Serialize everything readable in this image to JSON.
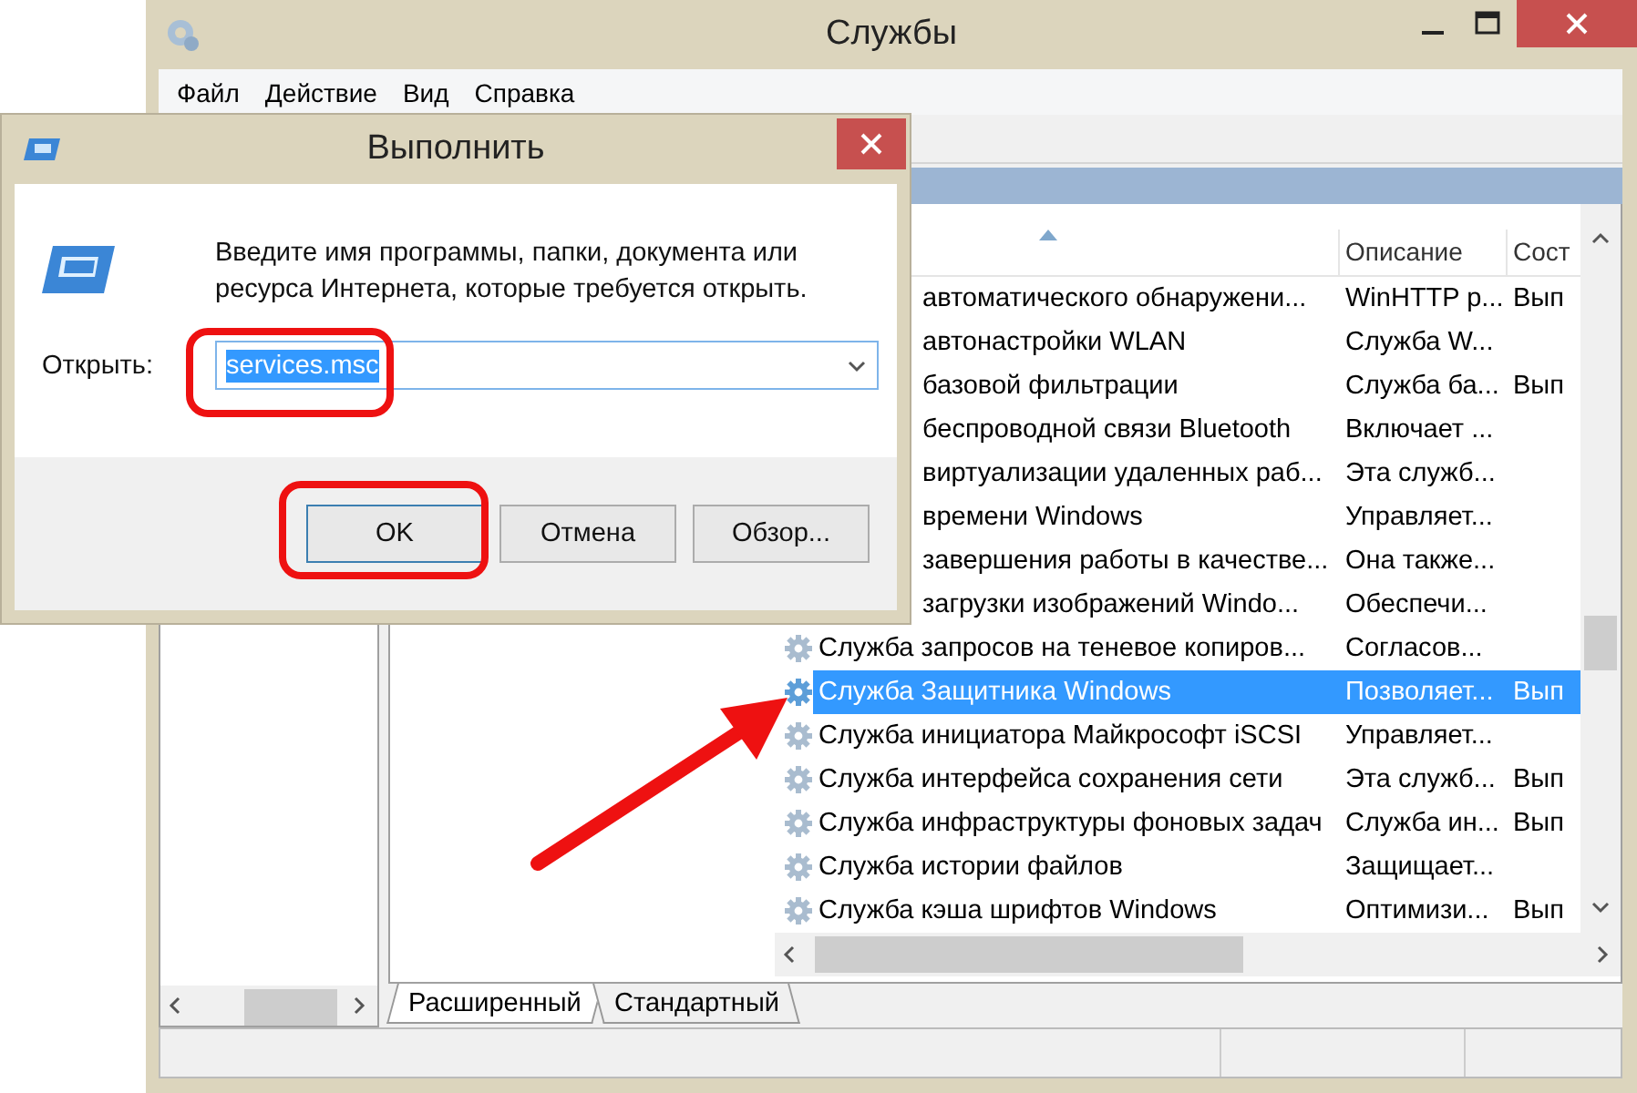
{
  "services_window": {
    "title": "Службы",
    "menu": [
      "Файл",
      "Действие",
      "Вид",
      "Справка"
    ],
    "list": {
      "columns": [
        "Описание",
        "Сост"
      ],
      "rows": [
        {
          "kind": "partial",
          "name": "автоматического обнаружени...",
          "description": "WinHTTP р...",
          "status": "Вып",
          "selected": false
        },
        {
          "kind": "partial",
          "name": "автонастройки WLAN",
          "description": "Служба W...",
          "selected": false
        },
        {
          "kind": "partial",
          "name": "базовой фильтрации",
          "description": "Служба ба...",
          "status": "Вып",
          "selected": false
        },
        {
          "kind": "partial",
          "name": "беспроводной связи Bluetooth",
          "description": "Включает ...",
          "selected": false
        },
        {
          "kind": "partial",
          "name": "виртуализации удаленных раб...",
          "description": "Эта служб...",
          "selected": false
        },
        {
          "kind": "partial",
          "name": "времени Windows",
          "description": "Управляет...",
          "selected": false
        },
        {
          "kind": "partial",
          "name": "завершения работы в качестве...",
          "description": "Она также...",
          "selected": false
        },
        {
          "kind": "partial",
          "name": "загрузки изображений Windo...",
          "description": "Обеспечи...",
          "selected": false
        },
        {
          "kind": "full",
          "name": "Служба запросов на теневое копиров...",
          "description": "Согласов...",
          "selected": false
        },
        {
          "kind": "full",
          "name": "Служба Защитника Windows",
          "description": "Позволяет...",
          "status": "Вып",
          "selected": true
        },
        {
          "kind": "full",
          "name": "Служба инициатора Майкрософт iSCSI",
          "description": "Управляет...",
          "selected": false
        },
        {
          "kind": "full",
          "name": "Служба интерфейса сохранения сети",
          "description": "Эта служб...",
          "status": "Вып",
          "selected": false
        },
        {
          "kind": "full",
          "name": "Служба инфраструктуры фоновых задач",
          "description": "Служба ин...",
          "status": "Вып",
          "selected": false
        },
        {
          "kind": "full",
          "name": "Служба истории файлов",
          "description": "Защищает...",
          "selected": false
        },
        {
          "kind": "full",
          "name": "Служба кэша шрифтов Windows",
          "description": "Оптимизи...",
          "status": "Вып",
          "selected": false
        }
      ]
    },
    "view_tabs": [
      {
        "label": "Расширенный",
        "selected": true
      },
      {
        "label": "Стандартный",
        "selected": false
      }
    ]
  },
  "run_dialog": {
    "title": "Выполнить",
    "prompt": "Введите имя программы, папки, документа или ресурса Интернета, которые требуется открыть.",
    "open_label": "Открыть:",
    "value": "services.msc",
    "buttons": [
      "OK",
      "Отмена",
      "Обзор..."
    ]
  }
}
